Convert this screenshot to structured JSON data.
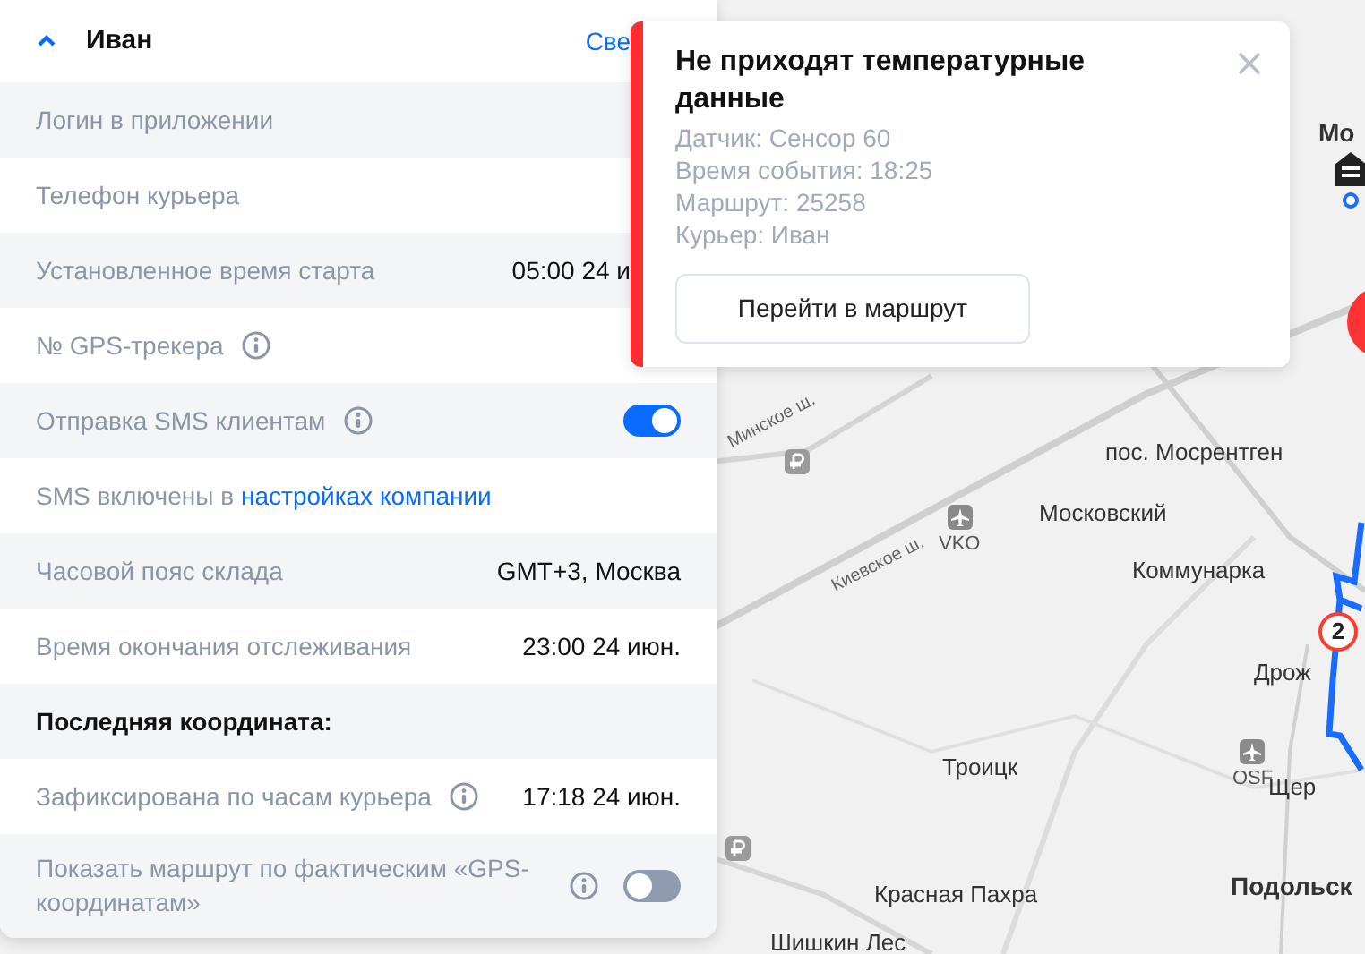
{
  "panel": {
    "expanded": true,
    "title": "Иван",
    "header_link": "Све",
    "rows": [
      {
        "kind": "field",
        "label": "Логин в приложении"
      },
      {
        "kind": "field",
        "label": "Телефон курьера"
      },
      {
        "kind": "field",
        "label": "Установленное время старта",
        "value": "05:00 24 и"
      },
      {
        "kind": "field",
        "label": "№ GPS-трекера",
        "info": true
      },
      {
        "kind": "toggle",
        "label": "Отправка SMS клиентам",
        "info": true,
        "on": true
      },
      {
        "kind": "note",
        "text": "SMS включены в",
        "link": "настройках компании"
      },
      {
        "kind": "field",
        "label": "Часовой пояс склада",
        "value": "GMT+3, Москва"
      },
      {
        "kind": "field",
        "label": "Время окончания отслеживания",
        "value": "23:00 24 июн."
      },
      {
        "kind": "heading",
        "text": "Последняя координата:"
      },
      {
        "kind": "field",
        "label": "Зафиксирована по часам курьера",
        "info": true,
        "value": "17:18 24 июн."
      },
      {
        "kind": "toggle",
        "label": "Показать маршрут по фактическим «GPS-координатам»",
        "info": true,
        "on": false
      }
    ]
  },
  "notification": {
    "title": "Не приходят температурные данные",
    "lines": [
      "Датчик: Сенсор 60",
      "Время события: 18:25",
      "Маршрут: 25258",
      "Курьер: Иван"
    ],
    "button": "Перейти в маршрут"
  },
  "map": {
    "labels": [
      {
        "kind": "road",
        "text": "Минское ш."
      },
      {
        "kind": "place",
        "text": "пос. Мосрентген"
      },
      {
        "kind": "airport",
        "text": "VKO"
      },
      {
        "kind": "place",
        "text": "Московский"
      },
      {
        "kind": "road",
        "text": "Киевское ш."
      },
      {
        "kind": "place",
        "text": "Коммунарка"
      },
      {
        "kind": "place",
        "text": "Дрож"
      },
      {
        "kind": "airport",
        "text": "OSF"
      },
      {
        "kind": "place",
        "text": "Щер"
      },
      {
        "kind": "place",
        "text": "Троицк"
      },
      {
        "kind": "city",
        "text": "Подольск"
      },
      {
        "kind": "place",
        "text": "Красная Пахра"
      },
      {
        "kind": "place",
        "text": "Шишкин Лес"
      },
      {
        "kind": "city",
        "text": "Мо"
      }
    ],
    "stop_marker": "2"
  }
}
